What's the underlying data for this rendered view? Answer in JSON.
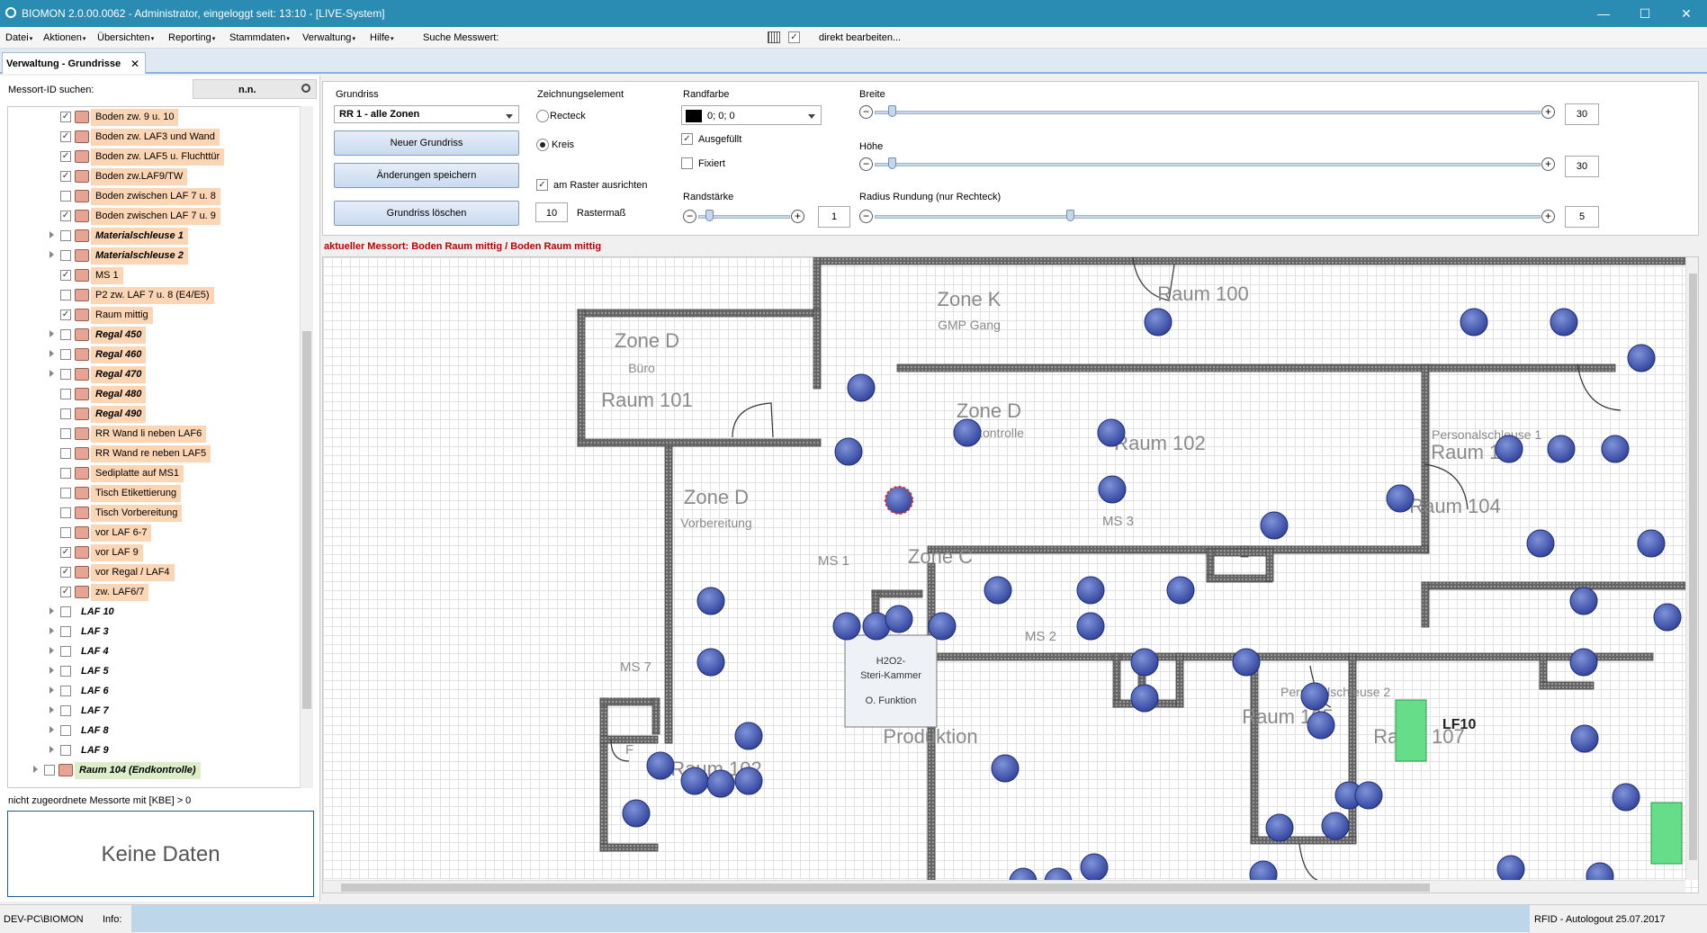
{
  "window": {
    "title": "BIOMON 2.0.00.0062 - Administrator, eingeloggt seit: 13:10 - [LIVE-System]",
    "controls": {
      "minimize": "—",
      "maximize": "☐",
      "close": "✕"
    }
  },
  "menu": {
    "items": [
      "Datei",
      "Aktionen",
      "Übersichten",
      "Reporting",
      "Stammdaten",
      "Verwaltung",
      "Hilfe"
    ],
    "search_label": "Suche Messwert:",
    "edit_direct_label": "direkt bearbeiten..."
  },
  "tab": {
    "label": "Verwaltung - Grundrisse",
    "close": "✕"
  },
  "left_panel": {
    "search_label": "Messort-ID suchen:",
    "search_value": "n.n.",
    "tree": [
      {
        "label": "Boden zw. 9 u. 10",
        "checked": true,
        "level": 3,
        "style": "orange"
      },
      {
        "label": "Boden zw. LAF3 und Wand",
        "checked": true,
        "level": 3,
        "style": "orange"
      },
      {
        "label": "Boden zw. LAF5 u. Fluchttür",
        "checked": true,
        "level": 3,
        "style": "orange"
      },
      {
        "label": "Boden zw.LAF9/TW",
        "checked": true,
        "level": 3,
        "style": "orange"
      },
      {
        "label": "Boden zwischen LAF 7 u. 8",
        "checked": false,
        "level": 3,
        "style": "orange"
      },
      {
        "label": "Boden zwischen LAF 7 u. 9",
        "checked": true,
        "level": 3,
        "style": "orange"
      },
      {
        "label": "Materialschleuse 1",
        "checked": false,
        "level": 3,
        "style": "orange-bi",
        "expandable": true
      },
      {
        "label": "Materialschleuse 2",
        "checked": false,
        "level": 3,
        "style": "orange-bi",
        "expandable": true
      },
      {
        "label": "MS 1",
        "checked": true,
        "level": 3,
        "style": "orange"
      },
      {
        "label": "P2 zw. LAF 7 u. 8 (E4/E5)",
        "checked": false,
        "level": 3,
        "style": "orange"
      },
      {
        "label": "Raum mittig",
        "checked": true,
        "level": 3,
        "style": "orange"
      },
      {
        "label": "Regal 450",
        "checked": false,
        "level": 3,
        "style": "orange-bi",
        "expandable": true
      },
      {
        "label": "Regal 460",
        "checked": false,
        "level": 3,
        "style": "orange-bi",
        "expandable": true
      },
      {
        "label": "Regal 470",
        "checked": false,
        "level": 3,
        "style": "orange-bi",
        "expandable": true
      },
      {
        "label": "Regal 480",
        "checked": false,
        "level": 3,
        "style": "orange-bi"
      },
      {
        "label": "Regal 490",
        "checked": false,
        "level": 3,
        "style": "orange-bi"
      },
      {
        "label": "RR Wand li neben LAF6",
        "checked": false,
        "level": 3,
        "style": "orange"
      },
      {
        "label": "RR Wand re neben LAF5",
        "checked": false,
        "level": 3,
        "style": "orange"
      },
      {
        "label": "Sediplatte auf MS1",
        "checked": false,
        "level": 3,
        "style": "orange"
      },
      {
        "label": "Tisch Etikettierung",
        "checked": false,
        "level": 3,
        "style": "orange"
      },
      {
        "label": "Tisch Vorbereitung",
        "checked": false,
        "level": 3,
        "style": "orange"
      },
      {
        "label": "vor LAF 6-7",
        "checked": false,
        "level": 3,
        "style": "orange"
      },
      {
        "label": "vor LAF 9",
        "checked": true,
        "level": 3,
        "style": "orange"
      },
      {
        "label": "vor Regal / LAF4",
        "checked": true,
        "level": 3,
        "style": "orange"
      },
      {
        "label": "zw. LAF6/7",
        "checked": true,
        "level": 3,
        "style": "orange"
      },
      {
        "label": "LAF 10",
        "checked": false,
        "level": 2,
        "style": "bi",
        "expandable": true
      },
      {
        "label": "LAF 3",
        "checked": false,
        "level": 2,
        "style": "bi",
        "expandable": true
      },
      {
        "label": "LAF 4",
        "checked": false,
        "level": 2,
        "style": "bi",
        "expandable": true
      },
      {
        "label": "LAF 5",
        "checked": false,
        "level": 2,
        "style": "bi",
        "expandable": true
      },
      {
        "label": "LAF 6",
        "checked": false,
        "level": 2,
        "style": "bi",
        "expandable": true
      },
      {
        "label": "LAF 7",
        "checked": false,
        "level": 2,
        "style": "bi",
        "expandable": true
      },
      {
        "label": "LAF 8",
        "checked": false,
        "level": 2,
        "style": "bi",
        "expandable": true
      },
      {
        "label": "LAF 9",
        "checked": false,
        "level": 2,
        "style": "bi",
        "expandable": true
      },
      {
        "label": "Raum 104 (Endkontrolle)",
        "checked": false,
        "level": 1,
        "style": "green-bi",
        "expandable": true
      }
    ],
    "unassigned_label": "nicht zugeordnete Messorte mit [KBE] > 0",
    "no_data": "Keine Daten"
  },
  "toolbar": {
    "grundriss_label": "Grundriss",
    "grundriss_value": "RR 1 - alle Zonen",
    "btn_new": "Neuer Grundriss",
    "btn_save": "Änderungen speichern",
    "btn_delete": "Grundriss löschen",
    "element_label": "Zeichnungselement",
    "radio_rect": "Recteck",
    "radio_circle": "Kreis",
    "raster_label": "am Raster ausrichten",
    "raster_value": "10",
    "raster_unit": "Rastermaß",
    "randfarbe_label": "Randfarbe",
    "randfarbe_value": "0; 0; 0",
    "randfarbe_color": "#000000",
    "ausgefuellt": "Ausgefüllt",
    "fixiert": "Fixiert",
    "randstaerke_label": "Randstärke",
    "randstaerke_value": "1",
    "breite_label": "Breite",
    "breite_value": "30",
    "hoehe_label": "Höhe",
    "hoehe_value": "30",
    "radius_label": "Radius Rundung (nur Rechteck)",
    "radius_value": "5"
  },
  "messort": "aktueller Messort: Boden Raum mittig / Boden Raum mittig",
  "floorplan": {
    "labels": [
      {
        "text": "Zone K",
        "size": "big"
      },
      {
        "text": "GMP Gang",
        "size": "small"
      },
      {
        "text": "Raum 100",
        "size": "big"
      },
      {
        "text": "Zone D",
        "size": "big"
      },
      {
        "text": "Büro",
        "size": "small"
      },
      {
        "text": "Raum 101",
        "size": "big"
      },
      {
        "text": "Zone D",
        "size": "big"
      },
      {
        "text": "Endkontrolle",
        "size": "small"
      },
      {
        "text": "Raum 102",
        "size": "big"
      },
      {
        "text": "Personalschleuse 1",
        "size": "small"
      },
      {
        "text": "Raum 103",
        "size": "big"
      },
      {
        "text": "Zone D",
        "size": "big"
      },
      {
        "text": "Vorbereitung",
        "size": "small"
      },
      {
        "text": "Raum 104",
        "size": "big"
      },
      {
        "text": "MS 3",
        "size": "mid"
      },
      {
        "text": "Zone C",
        "size": "big"
      },
      {
        "text": "MS 1",
        "size": "mid"
      },
      {
        "text": "MS 2",
        "size": "mid"
      },
      {
        "text": "MS 7",
        "size": "mid"
      },
      {
        "text": "Personalschleuse 2",
        "size": "small"
      },
      {
        "text": "Raum 105",
        "size": "big"
      },
      {
        "text": "Produktion",
        "size": "big"
      },
      {
        "text": "Raum 102",
        "size": "big"
      },
      {
        "text": "Raum 107",
        "size": "big"
      },
      {
        "text": "F",
        "size": "mid"
      }
    ],
    "box_lines": [
      "H2O2-",
      "Steri-Kammer",
      "O. Funktion"
    ],
    "lf10_label": "LF10"
  },
  "statusbar": {
    "computer": "DEV-PC\\BIOMON",
    "info_label": "Info:",
    "right": "RFID - Autologout 25.07.2017"
  },
  "colors": {
    "title_bar": "#2a8bb3",
    "dot": "#3a4fa8",
    "selected_dot": "#d03030",
    "lf_green": "#66dd88"
  }
}
